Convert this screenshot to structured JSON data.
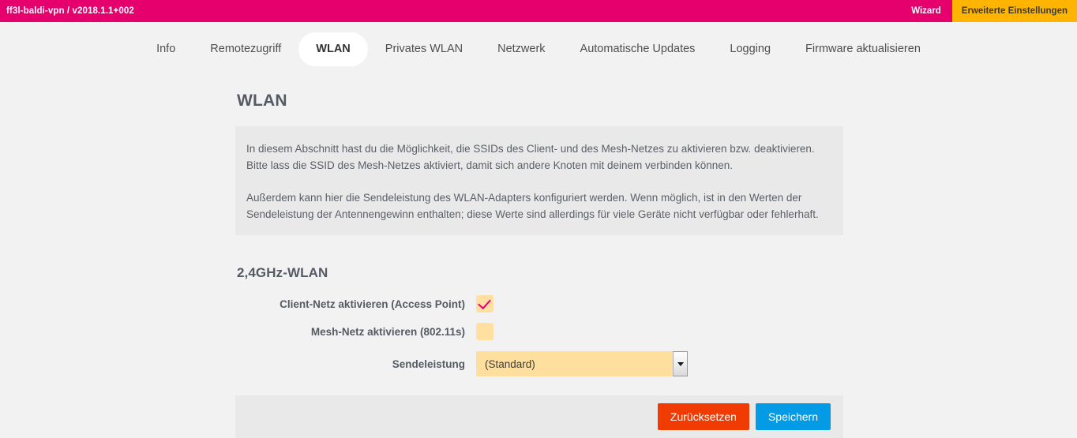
{
  "topbar": {
    "brand": "ff3l-baldi-vpn / v2018.1.1+002",
    "wizard_label": "Wizard",
    "advanced_label": "Erweiterte Einstellungen",
    "bg_color": "#e5006d",
    "highlight_color": "#ffb400"
  },
  "nav": {
    "items": [
      {
        "label": "Info",
        "active": false
      },
      {
        "label": "Remotezugriff",
        "active": false
      },
      {
        "label": "WLAN",
        "active": true
      },
      {
        "label": "Privates WLAN",
        "active": false
      },
      {
        "label": "Netzwerk",
        "active": false
      },
      {
        "label": "Automatische Updates",
        "active": false
      },
      {
        "label": "Logging",
        "active": false
      },
      {
        "label": "Firmware aktualisieren",
        "active": false
      }
    ]
  },
  "page": {
    "title": "WLAN",
    "info_paragraph_1": "In diesem Abschnitt hast du die Möglichkeit, die SSIDs des Client- und des Mesh-Netzes zu aktivieren bzw. deaktivieren. Bitte lass die SSID des Mesh-Netzes aktiviert, damit sich andere Knoten mit deinem verbinden können.",
    "info_paragraph_2": "Außerdem kann hier die Sendeleistung des WLAN-Adapters konfiguriert werden. Wenn möglich, ist in den Werten der Sendeleistung der Antennengewinn enthalten; diese Werte sind allerdings für viele Geräte nicht verfügbar oder fehlerhaft.",
    "section_title": "2,4GHz-WLAN"
  },
  "form": {
    "client_net_label": "Client-Netz aktivieren (Access Point)",
    "client_net_checked": true,
    "mesh_net_label": "Mesh-Netz aktivieren (802.11s)",
    "mesh_net_checked": false,
    "txpower_label": "Sendeleistung",
    "txpower_value": "(Standard)",
    "field_bg_color": "#ffdf9e"
  },
  "actions": {
    "reset_label": "Zurücksetzen",
    "save_label": "Speichern",
    "reset_color": "#f03c02",
    "save_color": "#039be5"
  }
}
